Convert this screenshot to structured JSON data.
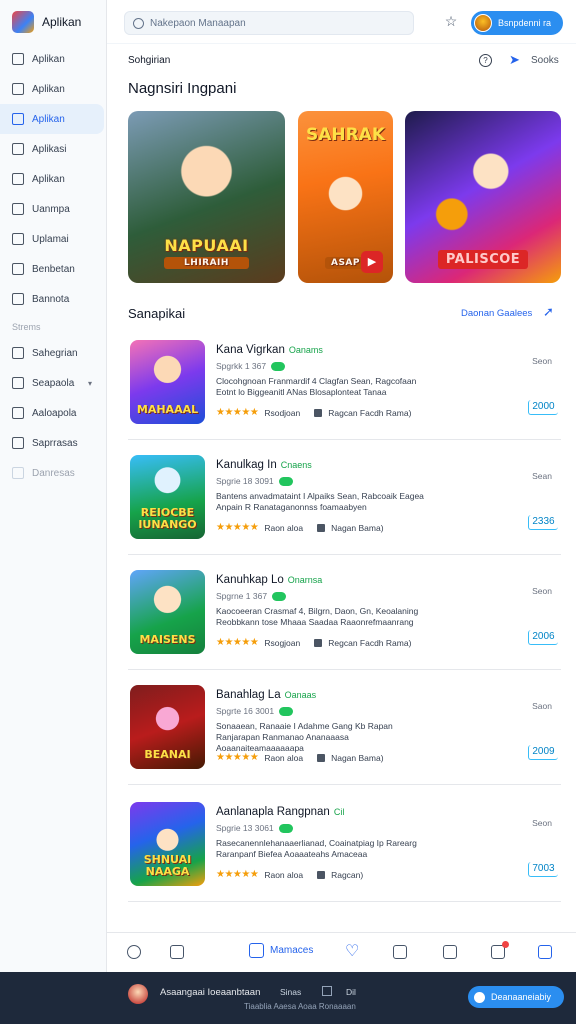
{
  "app": {
    "name": "Aplikan"
  },
  "sidebar": {
    "items": [
      {
        "label": "Aplikan",
        "icon": "apps-icon"
      },
      {
        "label": "Aplikan",
        "icon": "book-icon"
      },
      {
        "label": "Aplikan",
        "icon": "grid-icon",
        "active": true
      },
      {
        "label": "Aplikasi",
        "icon": "box-icon"
      },
      {
        "label": "Aplikan",
        "icon": "share-icon"
      },
      {
        "label": "Uanmpa",
        "icon": "screen-icon"
      },
      {
        "label": "Uplamai",
        "icon": "chart-icon"
      },
      {
        "label": "Benbetan",
        "icon": "list-icon"
      },
      {
        "label": "Bannota",
        "icon": "tv-icon"
      }
    ],
    "section_label": "Strems",
    "section_items": [
      {
        "label": "Sahegrian",
        "icon": "refresh-icon"
      },
      {
        "label": "Seapaola",
        "icon": "chat-icon",
        "chevron": "▾"
      },
      {
        "label": "Aaloapola",
        "icon": "settings-icon"
      },
      {
        "label": "Saprrasas",
        "icon": "folder-icon"
      },
      {
        "label": "Danresas",
        "icon": "archive-icon",
        "dim": true
      }
    ]
  },
  "topbar": {
    "search_placeholder": "Nakepaon Manaapan",
    "user_label": "Bsnpdenni ra"
  },
  "main": {
    "section_heading": "Sohgirian",
    "section_link": "Sooks",
    "featured_title": "Nagnsiri Ingpani",
    "featured": [
      {
        "title": "NAPUAAI",
        "subtitle": "LHIRAIH"
      },
      {
        "title": "SAHRAK",
        "subtitle": "ASAP"
      },
      {
        "title": "PALISCOE"
      }
    ],
    "list_title": "Sanapikai",
    "list_link": "Daonan Gaalees",
    "rows": [
      {
        "icon_text": "MAHAAAL",
        "title": "Kana Vigrkan",
        "tag": "Oanams",
        "meta": "Spgrkk 1 367",
        "desc": "Clocohgnoan Franmardif 4 Clagfan Sean, Ragcofaan Eotnt lo Biggeanitl ANas Blosaplonteat Tanaa",
        "reviews": "Rsodjoan",
        "publisher": "Ragcan Facdh Rama)",
        "side": "Seon",
        "price": "2000"
      },
      {
        "icon_text": "REIOCBE IUNANGO",
        "title": "Kanulkag In",
        "tag": "Cnaens",
        "meta": "Spgrie 18 3091",
        "desc": "Bantens anvadmataint I Alpaiks Sean, Rabcoaik Eagea Anpain R Ranataganonnss foamaabyen",
        "reviews": "Raon aloa",
        "publisher": "Nagan Bama)",
        "side": "Sean",
        "price": "2336"
      },
      {
        "icon_text": "MAISENS",
        "title": "Kanuhkap Lo",
        "tag": "Onarnsa",
        "meta": "Spgrne 1 367",
        "desc": "Kaocoeeran Crasmaf 4, Bilgrn, Daon, Gn, Keoalaning Reobbkann tose Mhaaa Saadaa Raaonrefmaanrang",
        "reviews": "Rsogjoan",
        "publisher": "Regcan Facdh Rama)",
        "side": "Seon",
        "price": "2006"
      },
      {
        "icon_text": "BEANAI",
        "title": "Banahlag La",
        "tag": "Oanaas",
        "meta": "Spgrte 16 3001",
        "desc": "Sonaaean, Ranaaie I Adahme Gang Kb Rapan Ranjarapan Ranmanao Ananaaasa Aoaanaiteamaaaaaapa",
        "reviews": "Raon aloa",
        "publisher": "Nagan Bama)",
        "side": "Saon",
        "price": "2009"
      },
      {
        "icon_text": "SHNUAI NAAGA",
        "title": "Aanlanapla Rangpnan",
        "tag": "Cil",
        "meta": "Spgrie 13 3061",
        "desc": "Rasecanennlehanaaerlianad, Coainatpiag Ip Rarearg Raranpanf Biefea Aoaaateahs Amaceaa",
        "reviews": "Raon aloa",
        "publisher": "Ragcan)",
        "side": "Seon",
        "price": "7003"
      }
    ]
  },
  "tabbar": {
    "active_label": "Mamaces"
  },
  "footer": {
    "name": "Asaangaai Ioeaanbtaan",
    "mid": "Sinas",
    "mid2": "Dil",
    "sub": "Tiaablia Aaesa Aoaa Ronaaaan",
    "button": "Deanaaneiabiy"
  }
}
